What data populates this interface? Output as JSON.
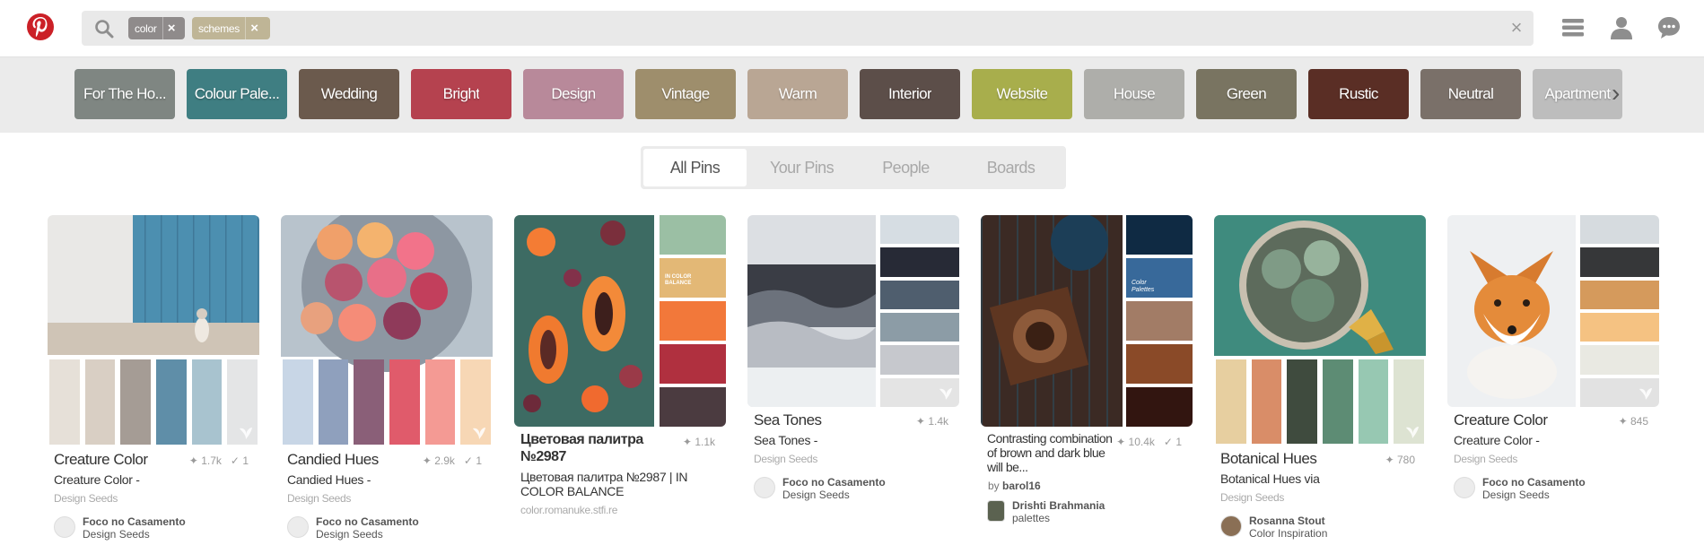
{
  "search": {
    "chips": [
      "color",
      "schemes"
    ],
    "chip_remove": "×",
    "clear": "×"
  },
  "guides": [
    {
      "label": "For The Ho...",
      "color": "#7f8682"
    },
    {
      "label": "Colour Pale...",
      "color": "#3f7e82"
    },
    {
      "label": "Wedding",
      "color": "#6b5a4d"
    },
    {
      "label": "Bright",
      "color": "#b5424f"
    },
    {
      "label": "Design",
      "color": "#b8899a"
    },
    {
      "label": "Vintage",
      "color": "#9e8e6c"
    },
    {
      "label": "Warm",
      "color": "#b9a694"
    },
    {
      "label": "Interior",
      "color": "#5c4e49"
    },
    {
      "label": "Website",
      "color": "#a8ae4c"
    },
    {
      "label": "House",
      "color": "#aeaeaa"
    },
    {
      "label": "Green",
      "color": "#797461"
    },
    {
      "label": "Rustic",
      "color": "#5a2e25"
    },
    {
      "label": "Neutral",
      "color": "#7a7069"
    },
    {
      "label": "Apartment",
      "color": "#bdbdbd"
    }
  ],
  "guide_next": "›",
  "tabs": [
    "All Pins",
    "Your Pins",
    "People",
    "Boards"
  ],
  "pins": [
    {
      "title": "Creature Color",
      "repins": "1.7k",
      "likes": "1",
      "desc": "Creature Color -",
      "domain": "Design Seeds",
      "attrib_name": "Foco no Casamento",
      "attrib_board": "Design Seeds",
      "swatches": [
        "#e6e0d8",
        "#d9cfc4",
        "#a59c95",
        "#5f8ea8",
        "#a8c3cf",
        "#e4e5e6"
      ]
    },
    {
      "title": "Candied Hues",
      "repins": "2.9k",
      "likes": "1",
      "desc": "Candied Hues -",
      "domain": "Design Seeds",
      "attrib_name": "Foco no Casamento",
      "attrib_board": "Design Seeds",
      "swatches": [
        "#c8d6e6",
        "#8fa0bd",
        "#8a5f78",
        "#e05b6b",
        "#f49a94",
        "#f7d7b5"
      ]
    },
    {
      "title": "Цветовая палитра №2987",
      "repins": "1.1k",
      "desc": "Цветовая палитра №2987 | IN COLOR BALANCE",
      "domain": "color.romanuke.stfi.re",
      "swatches": [
        "#9bbfa4",
        "#e3b876",
        "#f2783a",
        "#b0303f",
        "#4b3b40"
      ],
      "swatch_text": "IN COLOR BALANCE"
    },
    {
      "title": "Sea Tones",
      "repins": "1.4k",
      "desc": "Sea Tones -",
      "domain": "Design Seeds",
      "attrib_name": "Foco no Casamento",
      "attrib_board": "Design Seeds",
      "swatches": [
        "#d6dde3",
        "#272a36",
        "#4f5e6e",
        "#8c9ca6",
        "#c6c8cd",
        "#e4e4e4"
      ]
    },
    {
      "title": "Contrasting combination of brown and dark blue will be...",
      "repins": "10.4k",
      "likes": "1",
      "by_prefix": "by",
      "by_name": "barol16",
      "attrib_name": "Drishti Brahmania",
      "attrib_board": "palettes",
      "swatches": [
        "#0f2a43",
        "#38699a",
        "#a27c66",
        "#8a4a28",
        "#321510"
      ],
      "swatch_text": "Color Palettes"
    },
    {
      "title": "Botanical Hues",
      "repins": "780",
      "desc": "Botanical Hues via",
      "domain": "Design Seeds",
      "attrib_name": "Rosanna Stout",
      "attrib_board": "Color Inspiration",
      "swatches": [
        "#e7cfa0",
        "#d98d68",
        "#3f4b3e",
        "#5d8c74",
        "#97c8b2",
        "#dde3d2"
      ]
    },
    {
      "title": "Creature Color",
      "repins": "845",
      "desc": "Creature Color -",
      "domain": "Design Seeds",
      "attrib_name": "Foco no Casamento",
      "attrib_board": "Design Seeds",
      "swatches": [
        "#d6dbdf",
        "#363739",
        "#d59a5c",
        "#f5c282",
        "#e9e9e2",
        "#e2e2e2"
      ]
    }
  ]
}
